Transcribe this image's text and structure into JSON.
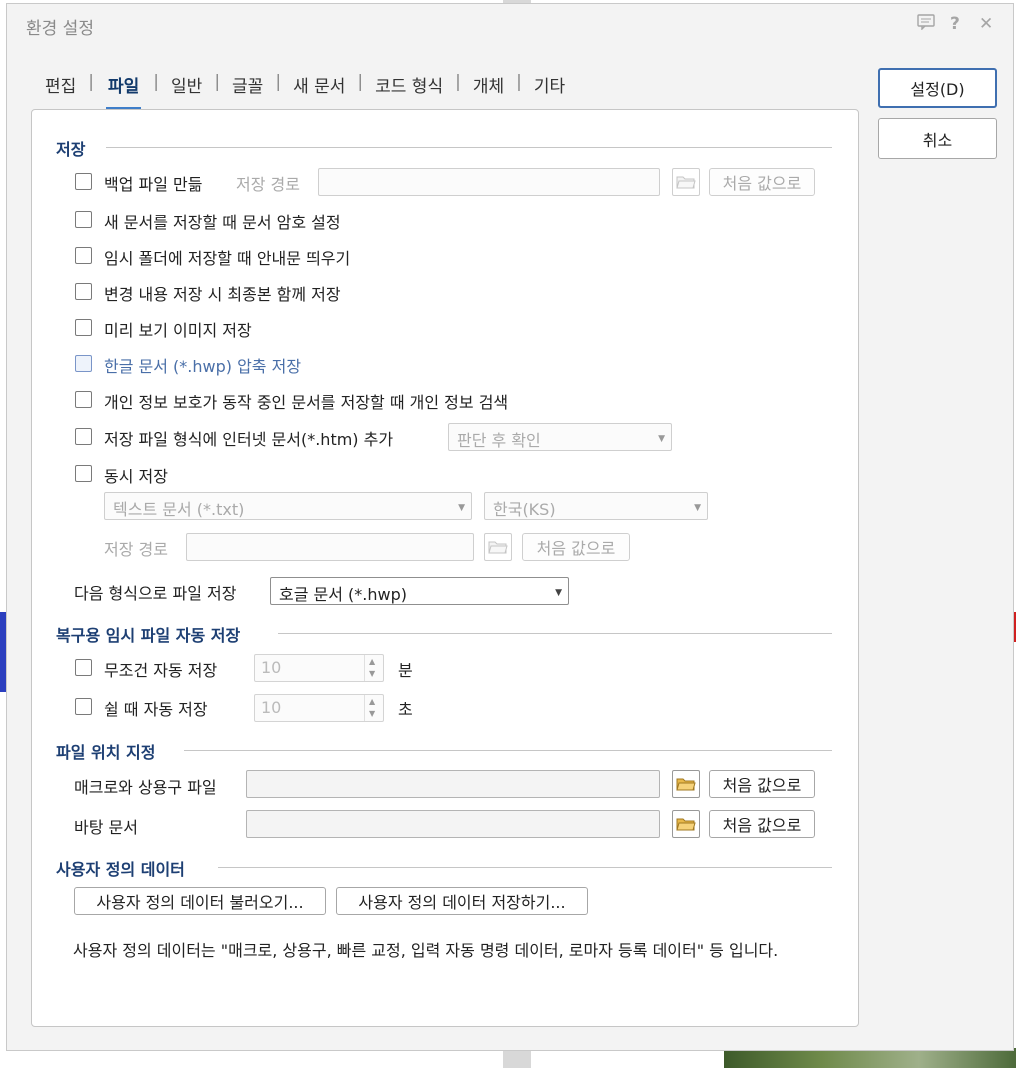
{
  "window": {
    "title": "환경 설정",
    "icons": [
      "comment-icon",
      "help-icon",
      "close-icon"
    ],
    "help_glyph": "?",
    "close_glyph": "✕"
  },
  "tabs": [
    "편집",
    "파일",
    "일반",
    "글꼴",
    "새 문서",
    "코드 형식",
    "개체",
    "기타"
  ],
  "active_tab": "파일",
  "side_buttons": {
    "ok": "설정(D)",
    "cancel": "취소"
  },
  "save": {
    "title": "저장",
    "backup": "백업 파일 만듦",
    "save_path_label": "저장 경로",
    "reset_label": "처음 값으로",
    "options": [
      "새 문서를 저장할 때 문서 암호 설정",
      "임시 폴더에 저장할 때 안내문 띄우기",
      "변경 내용 저장 시 최종본 함께 저장",
      "미리 보기 이미지 저장",
      "한글 문서 (*.hwp) 압축 저장",
      "개인 정보 보호가 동작 중인 문서를 저장할 때 개인 정보 검색",
      "저장 파일 형식에 인터넷 문서(*.htm) 추가"
    ],
    "htm_select": "판단 후 확인",
    "simultaneous": "동시 저장",
    "text_format": "텍스트 문서 (*.txt)",
    "encoding": "한국(KS)",
    "sim_path_label": "저장 경로",
    "sim_reset": "처음 값으로",
    "format_label": "다음 형식으로 파일 저장",
    "format_value": "호글 문서 (*.hwp)"
  },
  "autosave": {
    "title": "복구용 임시 파일 자동 저장",
    "always_label": "무조건 자동 저장",
    "always_value": "10",
    "always_unit": "분",
    "idle_label": "쉴 때 자동 저장",
    "idle_value": "10",
    "idle_unit": "초"
  },
  "location": {
    "title": "파일 위치 지정",
    "macro_label": "매크로와 상용구 파일",
    "template_label": "바탕 문서",
    "reset_label": "처음 값으로"
  },
  "userdata": {
    "title": "사용자 정의 데이터",
    "load": "사용자 정의 데이터 불러오기...",
    "save": "사용자 정의 데이터 저장하기...",
    "description": "사용자 정의 데이터는 \"매크로, 상용구, 빠른 교정, 입력 자동 명령 데이터, 로마자 등록 데이터\" 등 입니다."
  },
  "colors": {
    "accent": "#3f7ec9",
    "section": "#1d3f73",
    "folder": "#e8b84a"
  }
}
